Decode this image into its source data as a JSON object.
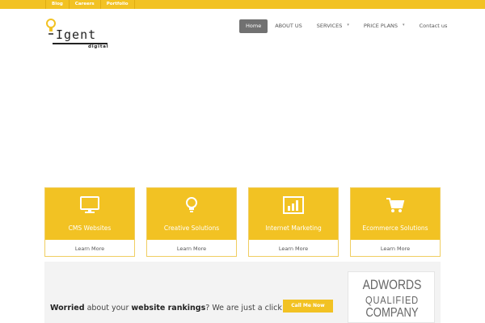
{
  "topbar": {
    "links": [
      "Blog",
      "Careers",
      "Portfolio"
    ],
    "color": "#f2c223"
  },
  "logo": {
    "word": "Igent",
    "sub": "digital"
  },
  "nav": {
    "items": [
      {
        "label": "Home",
        "active": true
      },
      {
        "label": "ABOUT US",
        "active": false
      },
      {
        "label": "SERVICES",
        "active": false,
        "dropdown": true
      },
      {
        "label": "PRICE PLANS",
        "active": false,
        "dropdown": true
      },
      {
        "label": "Contact us",
        "active": false
      }
    ]
  },
  "services": [
    {
      "title": "CMS Websites",
      "link": "Learn More",
      "icon": "monitor-icon"
    },
    {
      "title": "Creative Solutions",
      "link": "Learn More",
      "icon": "lightbulb-icon"
    },
    {
      "title": "Internet Marketing",
      "link": "Learn More",
      "icon": "bar-chart-icon"
    },
    {
      "title": "Ecommerce Solutions",
      "link": "Learn More",
      "icon": "shopping-cart-icon"
    }
  ],
  "cta": {
    "part1": "Worried",
    "part2": " about your ",
    "part3": "website rankings",
    "part4": "? We are just a click away",
    "button": "Call Me Now"
  },
  "badge": {
    "line1": "ADWORDS",
    "line2": "QUALIFIED",
    "line3": "COMPANY"
  },
  "colors": {
    "accent": "#f2c223",
    "nav_active": "#717171"
  }
}
